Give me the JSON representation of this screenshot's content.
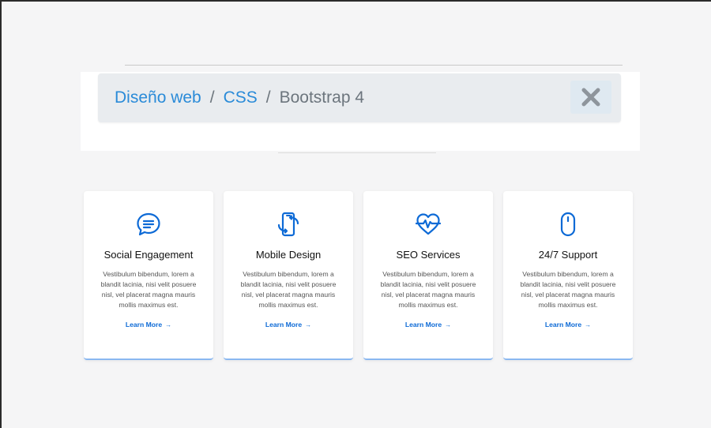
{
  "breadcrumb": {
    "items": [
      {
        "label": "Diseño web"
      },
      {
        "label": "CSS"
      }
    ],
    "separator": "/",
    "active": "Bootstrap 4",
    "close_icon": "close-icon"
  },
  "colors": {
    "accent": "#0d6ad6",
    "crumb_link": "#2a8bd8",
    "card_border": "#8ab8f1"
  },
  "cards": [
    {
      "icon": "chat-bubble-icon",
      "title": "Social Engagement",
      "text": "Vestibulum bibendum, lorem a blandit lacinia, nisi velit posuere nisl, vel placerat magna mauris mollis maximus est.",
      "link": "Learn More",
      "link_arrow": "→"
    },
    {
      "icon": "mobile-sync-icon",
      "title": "Mobile Design",
      "text": "Vestibulum bibendum, lorem a blandit lacinia, nisi velit posuere nisl, vel placerat magna mauris mollis maximus est.",
      "link": "Learn More",
      "link_arrow": "→"
    },
    {
      "icon": "heart-pulse-icon",
      "title": "SEO Services",
      "text": "Vestibulum bibendum, lorem a blandit lacinia, nisi velit posuere nisl, vel placerat magna mauris mollis maximus est.",
      "link": "Learn More",
      "link_arrow": "→"
    },
    {
      "icon": "mouse-icon",
      "title": "24/7 Support",
      "text": "Vestibulum bibendum, lorem a blandit lacinia, nisi velit posuere nisl, vel placerat magna mauris mollis maximus est.",
      "link": "Learn More",
      "link_arrow": "→"
    }
  ]
}
